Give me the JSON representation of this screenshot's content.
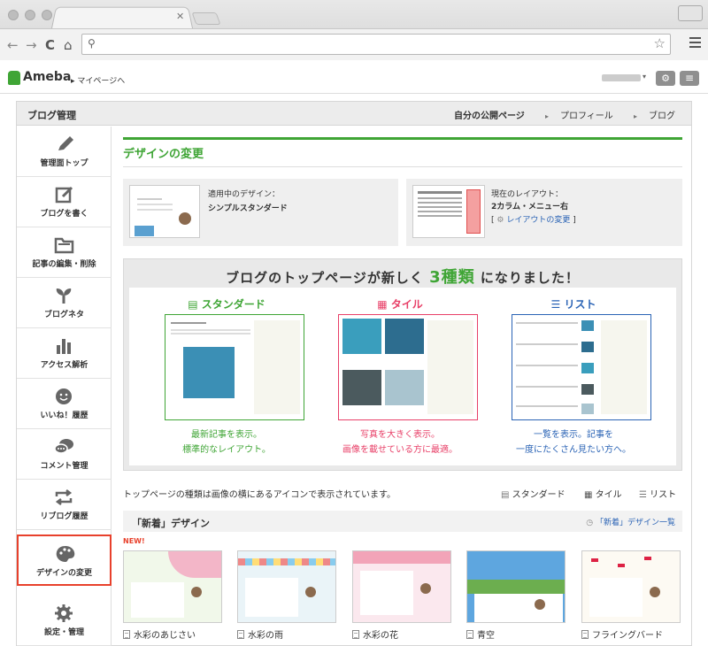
{
  "browser": {
    "nav_back": "←",
    "nav_forward": "→",
    "nav_reload": "C",
    "nav_home": "⌂",
    "url_value": "",
    "star": "☆"
  },
  "ameba": {
    "logo": "Ameba",
    "mypage": "マイページへ"
  },
  "page": {
    "title": "ブログ管理",
    "top_links": [
      "自分の公開ページ",
      "プロフィール",
      "ブログ"
    ]
  },
  "sidebar": {
    "items": [
      {
        "label": "管理面トップ",
        "icon": "pencil-icon"
      },
      {
        "label": "ブログを書く",
        "icon": "write-icon"
      },
      {
        "label": "記事の編集・削除",
        "icon": "folder-icon"
      },
      {
        "label": "ブログネタ",
        "icon": "sprout-icon"
      },
      {
        "label": "アクセス解析",
        "icon": "bar-chart-icon"
      },
      {
        "label": "いいね！履歴",
        "icon": "smile-icon"
      },
      {
        "label": "コメント管理",
        "icon": "comment-icon"
      },
      {
        "label": "リブログ履歴",
        "icon": "reblog-icon"
      },
      {
        "label": "デザインの変更",
        "icon": "palette-icon",
        "active": true
      },
      {
        "label": "設定・管理",
        "icon": "gear-icon"
      }
    ]
  },
  "main": {
    "heading": "デザインの変更",
    "current_design": {
      "label": "適用中のデザイン：",
      "value": "シンプルスタンダード"
    },
    "current_layout": {
      "label": "現在のレイアウト：",
      "value": "2カラム・メニュー右",
      "link": "レイアウトの変更",
      "bracket_open": "[",
      "bracket_close": "]"
    },
    "banner": {
      "title_pre": "ブログのトップページが新しく",
      "title_num": "3種類",
      "title_post": "になりました！",
      "columns": [
        {
          "head": "スタンダード",
          "line1": "最新記事を表示。",
          "line2": "標準的なレイアウト。",
          "color": "#3fa535"
        },
        {
          "head": "タイル",
          "line1": "写真を大きく表示。",
          "line2": "画像を載せている方に最適。",
          "color": "#e84068"
        },
        {
          "head": "リスト",
          "line1": "一覧を表示。記事を",
          "line2": "一度にたくさん見たい方へ。",
          "color": "#2a63b5"
        }
      ]
    },
    "note": "トップページの種類は画像の横にあるアイコンで表示されています。",
    "legend": [
      "スタンダード",
      "タイル",
      "リスト"
    ],
    "new_section": {
      "title": "「新着」デザイン",
      "link": "「新着」デザイン一覧",
      "new_tag": "NEW!",
      "designs": [
        "水彩のあじさい",
        "水彩の雨",
        "水彩の花",
        "青空",
        "フライングバード"
      ]
    }
  },
  "colors": {
    "accent_green": "#3fa535",
    "active_border": "#e8412c",
    "link_blue": "#2a63b5"
  }
}
